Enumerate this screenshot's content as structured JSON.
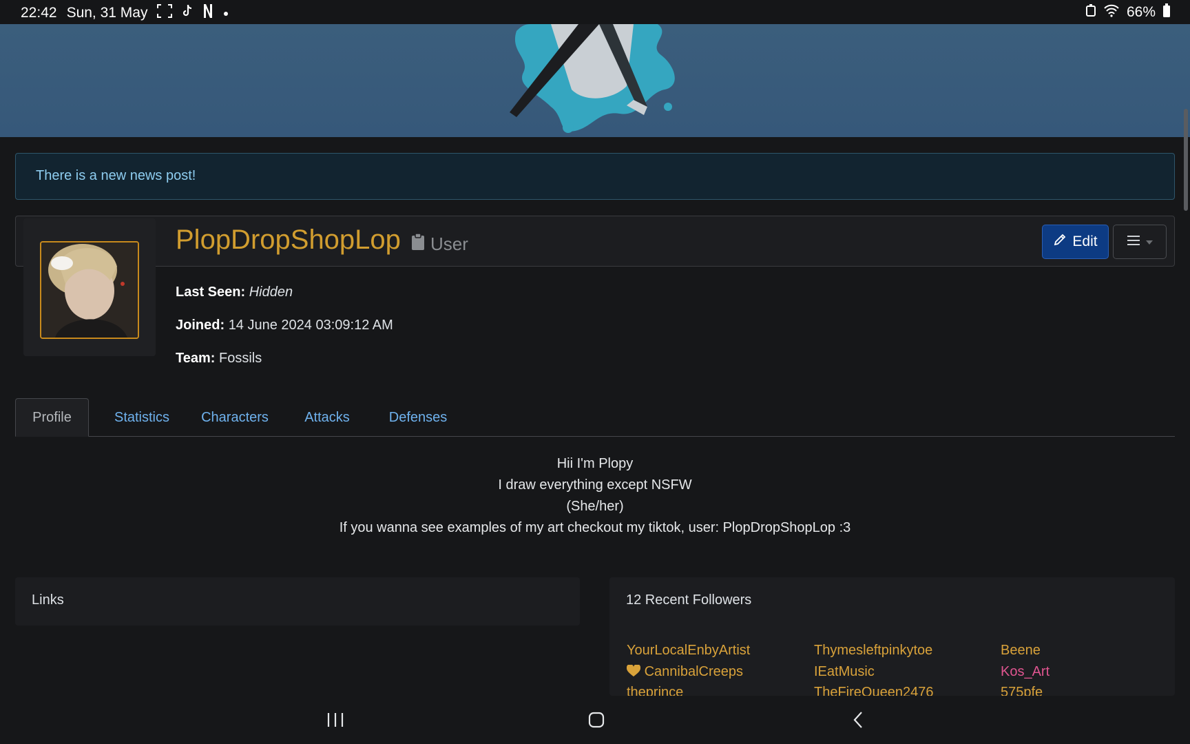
{
  "status_bar": {
    "time": "22:42",
    "date": "Sun, 31 May",
    "battery": "66%"
  },
  "alert": {
    "text": "There is a new news post!"
  },
  "profile": {
    "username": "PlopDropShopLop",
    "role": "User",
    "edit_label": "Edit",
    "last_seen_label": "Last Seen:",
    "last_seen_value": "Hidden",
    "joined_label": "Joined:",
    "joined_value": "14 June 2024 03:09:12 AM",
    "team_label": "Team:",
    "team_value": "Fossils"
  },
  "tabs": [
    {
      "label": "Profile",
      "active": true
    },
    {
      "label": "Statistics",
      "active": false
    },
    {
      "label": "Characters",
      "active": false
    },
    {
      "label": "Attacks",
      "active": false
    },
    {
      "label": "Defenses",
      "active": false
    }
  ],
  "bio": [
    "Hii I'm Plopy",
    "I draw everything except NSFW",
    "(She/her)",
    "If you wanna see examples of my art checkout my tiktok, user: PlopDropShopLop :3"
  ],
  "links_card": {
    "title": "Links"
  },
  "followers_card": {
    "title": "12 Recent Followers",
    "followers": [
      {
        "name": "YourLocalEnbyArtist",
        "color": "#d9a23a"
      },
      {
        "name": "Thymesleftpinkytoe",
        "color": "#d9a23a"
      },
      {
        "name": "Beene",
        "color": "#d9a23a"
      },
      {
        "name": "CannibalCreeps",
        "color": "#d9a23a",
        "icon": "heart-icon"
      },
      {
        "name": "IEatMusic",
        "color": "#d9a23a"
      },
      {
        "name": "Kos_Art",
        "color": "#e05590"
      },
      {
        "name": "theprince",
        "color": "#d9a23a"
      },
      {
        "name": "TheFireQueen2476",
        "color": "#d9a23a"
      },
      {
        "name": "575pfe",
        "color": "#d9a23a"
      }
    ]
  },
  "colors": {
    "accent_gold": "#d19d2f",
    "link_blue": "#6fb2ee",
    "edit_button": "#0d3b83"
  }
}
